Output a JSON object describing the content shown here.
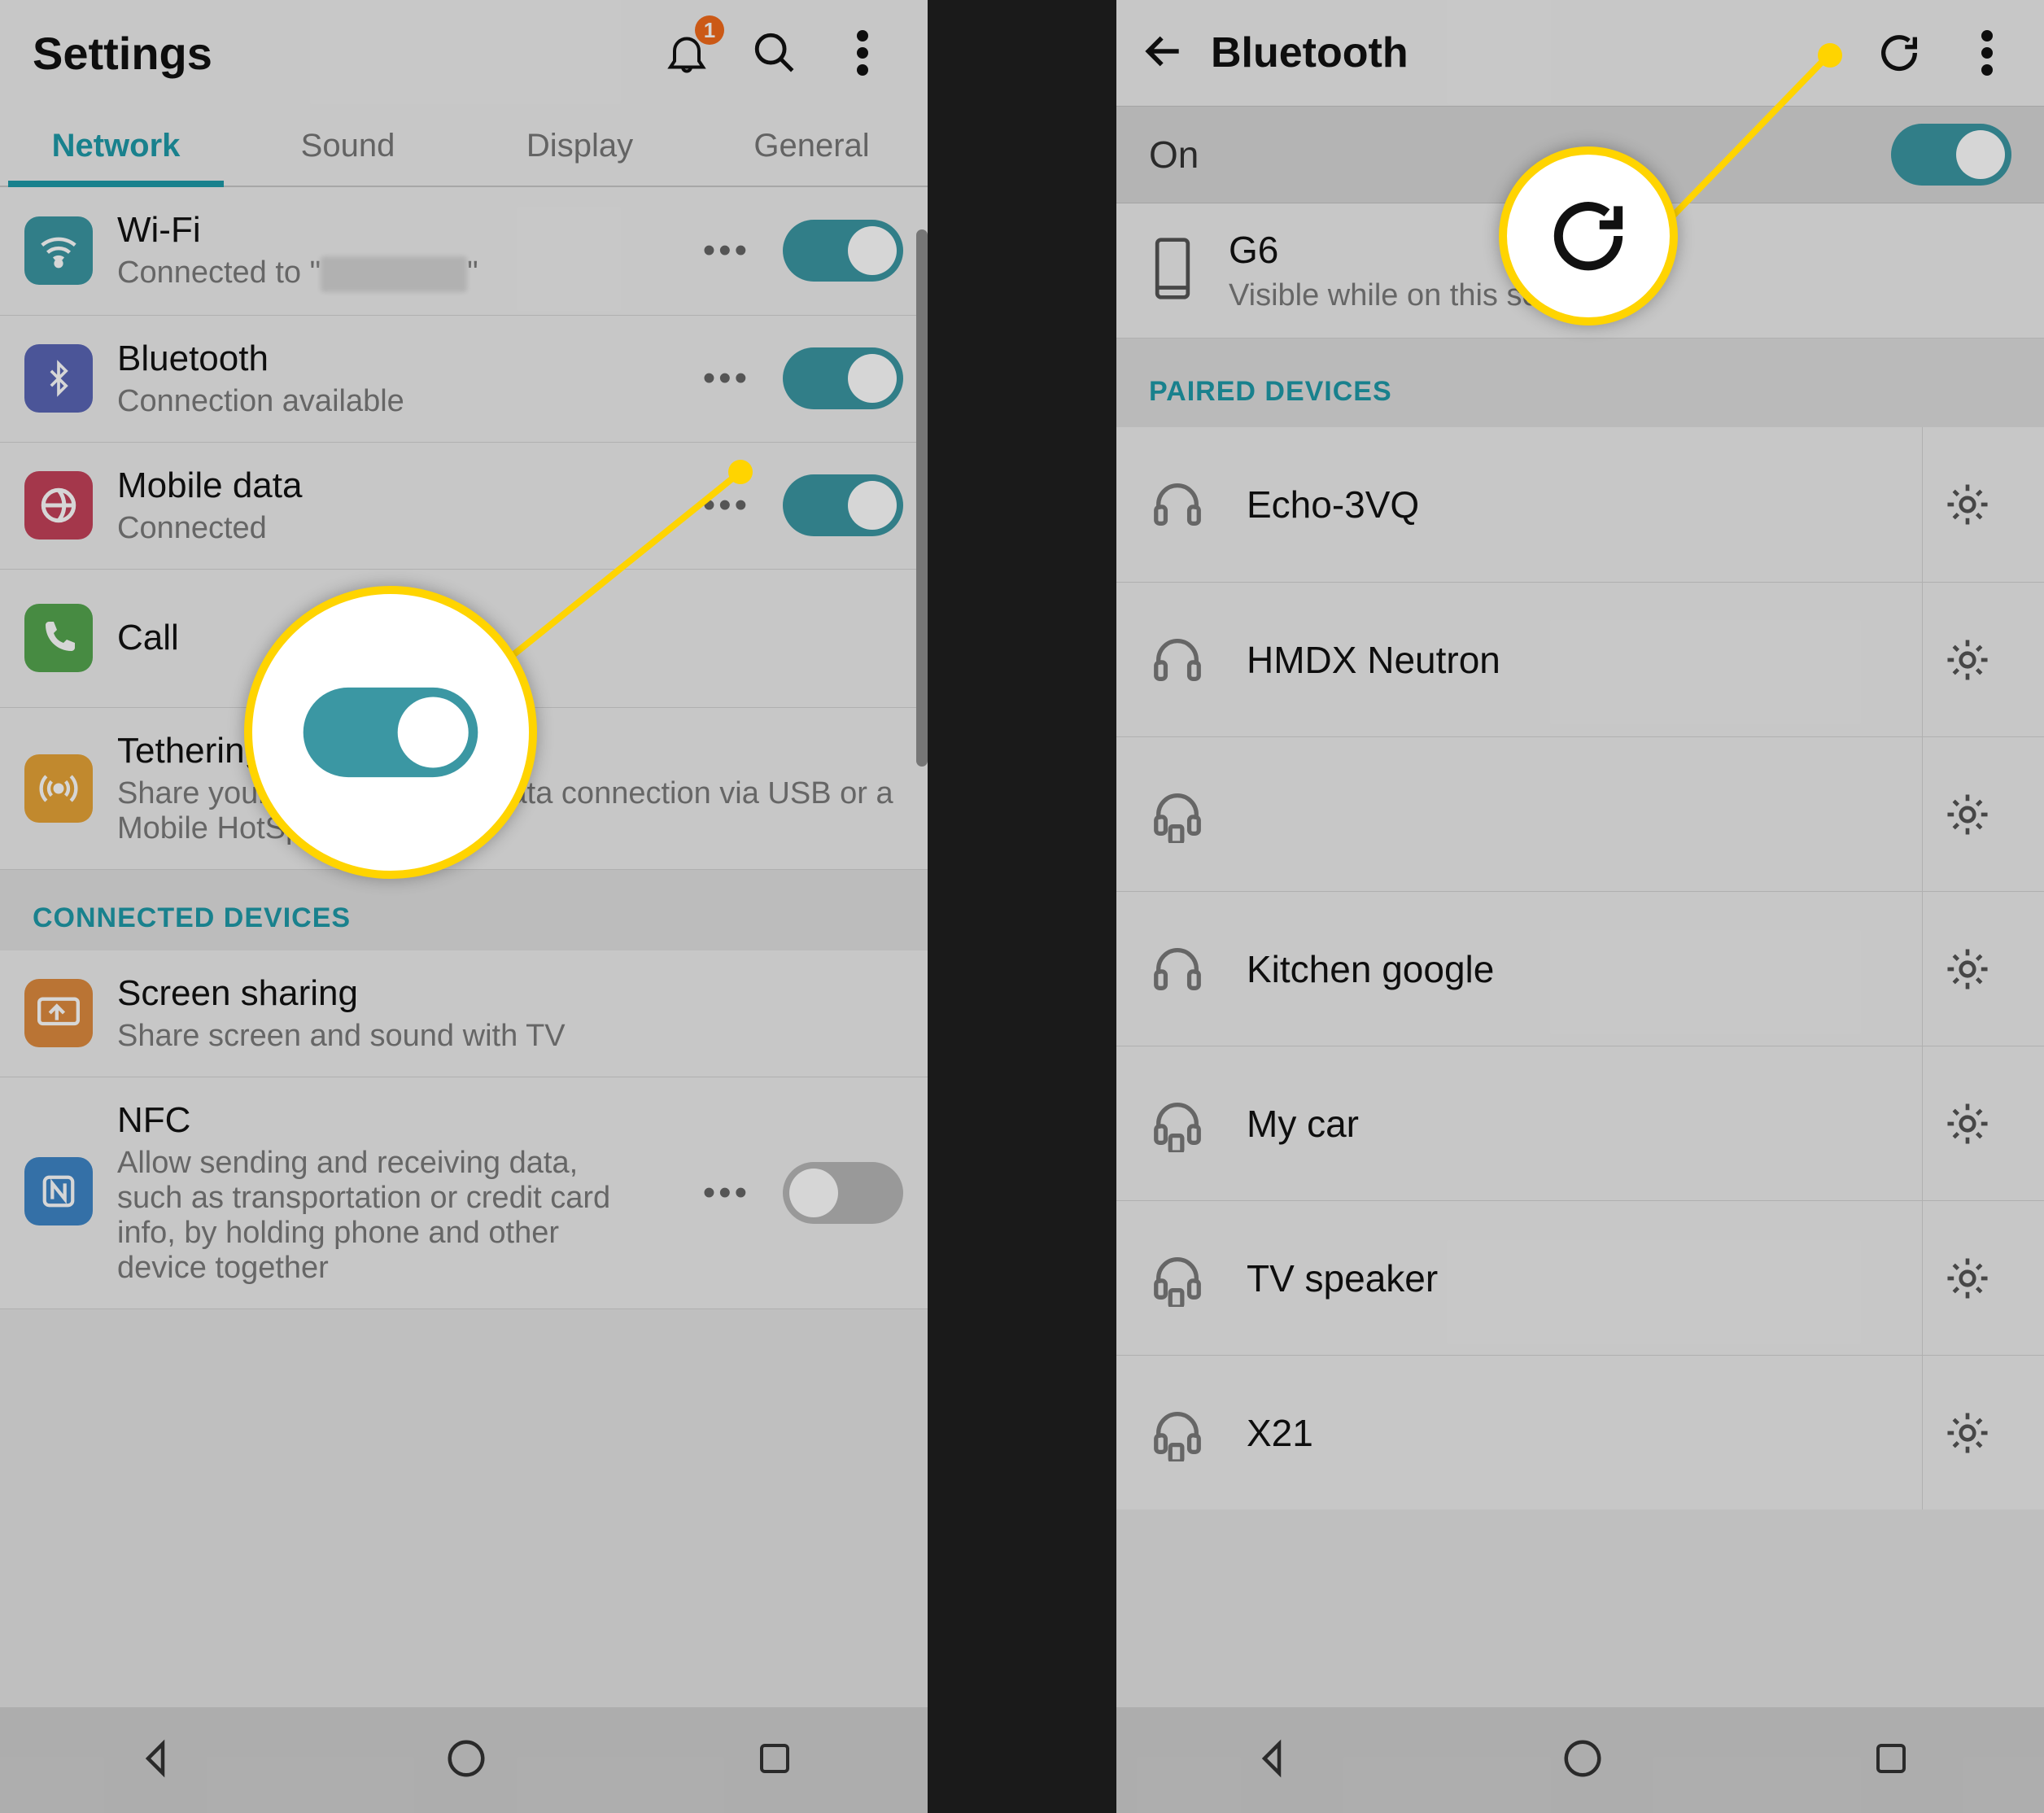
{
  "left": {
    "header": {
      "title": "Settings",
      "notif_count": "1"
    },
    "tabs": [
      "Network",
      "Sound",
      "Display",
      "General"
    ],
    "active_tab": 0,
    "rows": {
      "wifi": {
        "title": "Wi-Fi",
        "sub_prefix": "Connected to \"",
        "sub_suffix": "\""
      },
      "bluetooth": {
        "title": "Bluetooth",
        "sub": "Connection available"
      },
      "mobile": {
        "title": "Mobile data",
        "sub": "Connected"
      },
      "call": {
        "title": "Call"
      },
      "tether": {
        "title": "Tethering",
        "sub": "Share your phone's mobile data connection via USB or a Mobile HotSpot"
      },
      "screen": {
        "title": "Screen sharing",
        "sub": "Share screen and sound with TV"
      },
      "nfc": {
        "title": "NFC",
        "sub": "Allow sending and receiving data, such as transportation or credit card info, by holding phone and other device together"
      }
    },
    "section1": "CONNECTED DEVICES"
  },
  "right": {
    "title": "Bluetooth",
    "on_label": "On",
    "device": {
      "name": "G6",
      "sub": "Visible while on this screen"
    },
    "section": "PAIRED DEVICES",
    "paired": [
      {
        "name": "Echo-3VQ"
      },
      {
        "name": "HMDX Neutron"
      },
      {
        "name": ""
      },
      {
        "name": "Kitchen google"
      },
      {
        "name": "My car"
      },
      {
        "name": "TV speaker"
      },
      {
        "name": "X21"
      }
    ]
  },
  "colors": {
    "accent": "#1e9aa8",
    "highlight": "#ffd400"
  }
}
